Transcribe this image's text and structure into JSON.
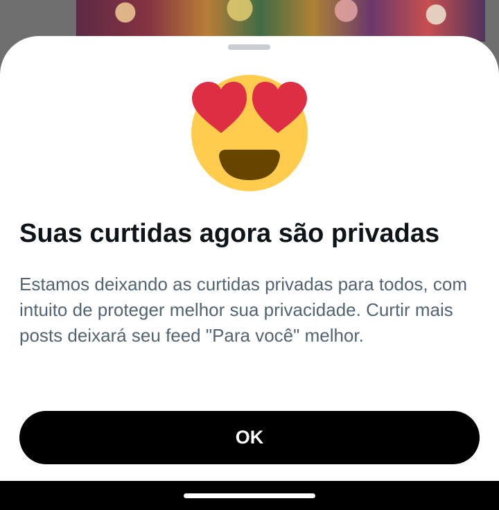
{
  "dialog": {
    "emoji": "heart-eyes-icon",
    "title": "Suas curtidas agora são privadas",
    "body": "Estamos deixando as curtidas privadas para todos, com intuito de proteger melhor sua privacidade. Curtir mais posts deixará seu feed \"Para você\" melhor.",
    "ok_label": "OK"
  },
  "colors": {
    "sheet_background": "#ffffff",
    "title": "#0f1419",
    "body": "#536471",
    "button_background": "#000000",
    "button_text": "#ffffff",
    "emoji_face": "#ffcc4d",
    "emoji_hearts": "#dd2e44",
    "emoji_mouth": "#664500"
  }
}
